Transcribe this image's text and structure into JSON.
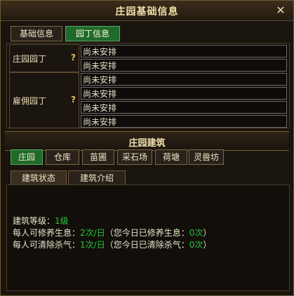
{
  "window": {
    "title": "庄园基础信息"
  },
  "main_tabs": [
    {
      "label": "基础信息",
      "active": false
    },
    {
      "label": "园丁信息",
      "active": true
    }
  ],
  "gardeners": {
    "estate_gardener": {
      "label": "庄园园丁",
      "help": "?",
      "rows": [
        "尚未安排",
        "尚未安排"
      ]
    },
    "hired_gardener": {
      "label": "雇佣园丁",
      "help": "?",
      "rows": [
        "尚未安排",
        "尚未安排",
        "尚未安排",
        "尚未安排"
      ]
    }
  },
  "buildings": {
    "section_title": "庄园建筑",
    "tabs": [
      {
        "label": "庄园",
        "active": true
      },
      {
        "label": "仓库",
        "active": false
      },
      {
        "label": "苗圃",
        "active": false
      },
      {
        "label": "采石场",
        "active": false
      },
      {
        "label": "荷塘",
        "active": false
      },
      {
        "label": "灵兽坊",
        "active": false
      }
    ],
    "sub_tabs": [
      {
        "label": "建筑状态",
        "active": true
      },
      {
        "label": "建筑介绍",
        "active": false
      }
    ]
  },
  "status": {
    "level_label": "建筑等级：",
    "level_value": "1级",
    "line2_prefix": "每人可修养生息：",
    "line2_value": "2次/日",
    "line2_mid": "（您今日已修养生息：",
    "line2_count": "0次",
    "line2_suffix": "）",
    "line3_prefix": "每人可清除杀气：",
    "line3_value": "1次/日",
    "line3_mid": "（您今日已清除杀气：",
    "line3_count": "0次",
    "line3_suffix": "）"
  },
  "colors": {
    "accent_green": "#27c43a",
    "text_gold": "#f0e0b0",
    "active_tab": "#1f6a2a"
  }
}
